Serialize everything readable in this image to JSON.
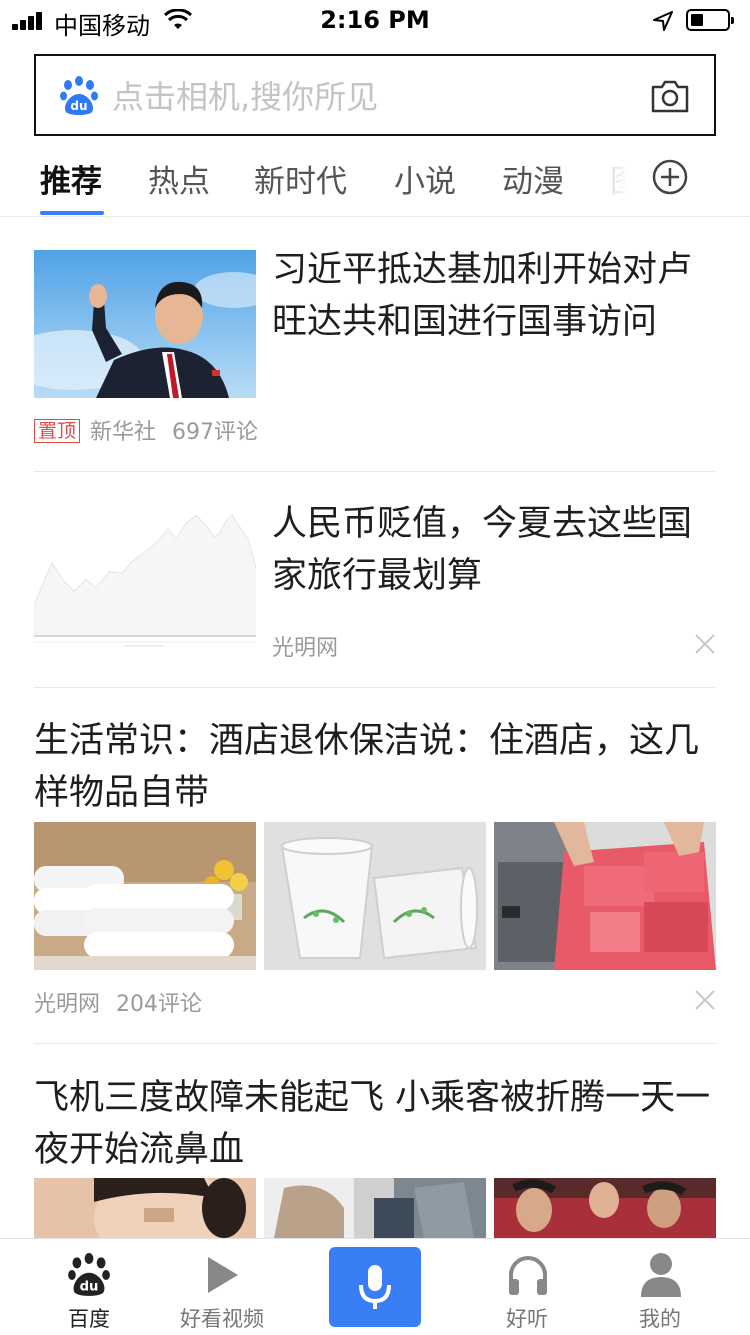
{
  "status_bar": {
    "carrier": "中国移动",
    "time": "2:16 PM"
  },
  "search": {
    "placeholder": "点击相机,搜你所见",
    "value": ""
  },
  "tabs": [
    {
      "label": "推荐",
      "active": true
    },
    {
      "label": "热点",
      "active": false
    },
    {
      "label": "新时代",
      "active": false
    },
    {
      "label": "小说",
      "active": false
    },
    {
      "label": "动漫",
      "active": false
    },
    {
      "label": "图",
      "active": false
    }
  ],
  "feed": [
    {
      "title": "习近平抵达基加利开始对卢旺达共和国进行国事访问",
      "pinned_label": "置顶",
      "source": "新华社",
      "comments": "697评论"
    },
    {
      "title": "人民币贬值，今夏去这些国家旅行最划算",
      "source": "光明网"
    },
    {
      "title": "生活常识：酒店退休保洁说：住酒店，这几样物品自带",
      "source": "光明网",
      "comments": "204评论"
    },
    {
      "title": "飞机三度故障未能起飞 小乘客被折腾一天一夜开始流鼻血"
    }
  ],
  "bottom_nav": [
    {
      "label": "百度",
      "icon": "baidu-paw-icon",
      "active": true
    },
    {
      "label": "好看视频",
      "icon": "play-icon",
      "active": false
    },
    {
      "label": "",
      "icon": "microphone-icon",
      "active": false
    },
    {
      "label": "好听",
      "icon": "headphones-icon",
      "active": false
    },
    {
      "label": "我的",
      "icon": "user-icon",
      "active": false
    }
  ],
  "colors": {
    "accent": "#3a7ef6",
    "pin_badge": "#e04b43",
    "meta_text": "#9a9a9a"
  }
}
